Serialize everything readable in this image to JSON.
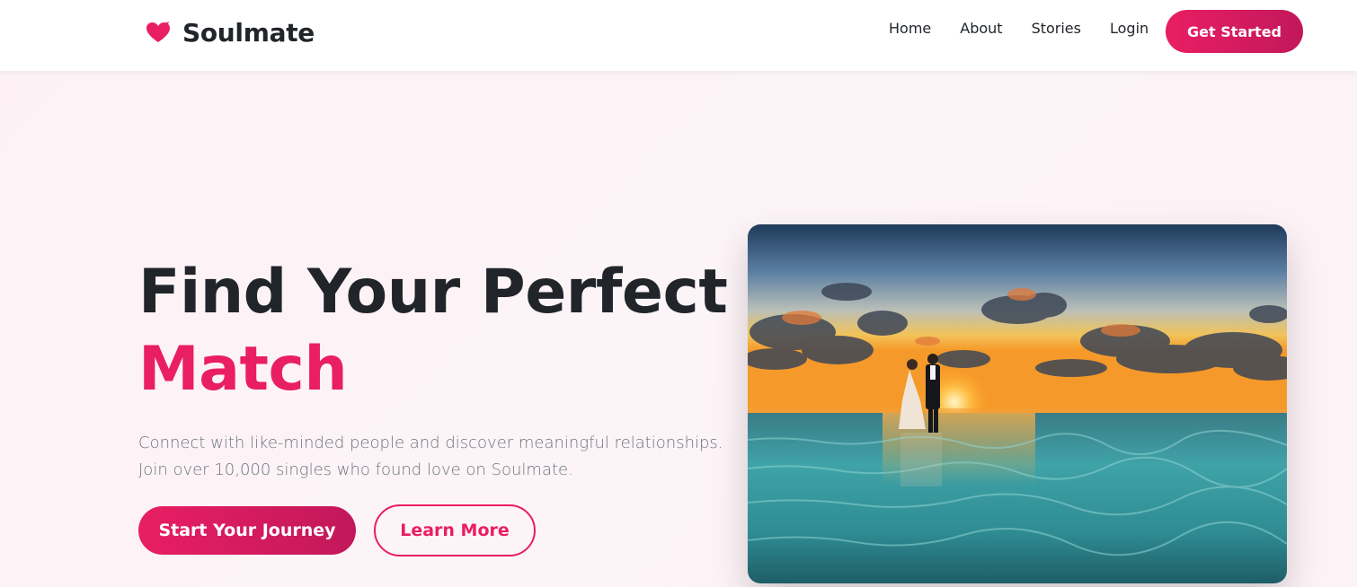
{
  "brand": {
    "name": "Soulmate",
    "icon": "heart-icon",
    "color": "#e91e63"
  },
  "nav": {
    "links": [
      "Home",
      "About",
      "Stories",
      "Login"
    ],
    "cta_label": "Get Started"
  },
  "hero": {
    "title_line1": "Find Your Perfect",
    "title_accent": "Match",
    "description_line1": "Connect with like-minded people and discover meaningful relationships.",
    "description_line2": "Join over 10,000 singles who found love on Soulmate.",
    "primary_button": "Start Your Journey",
    "secondary_button": "Learn More",
    "image": "couple-on-beach-at-sunset"
  },
  "colors": {
    "accent": "#e91e63",
    "accent_dark": "#c2185b",
    "text": "#212529",
    "muted": "#6c757d"
  }
}
